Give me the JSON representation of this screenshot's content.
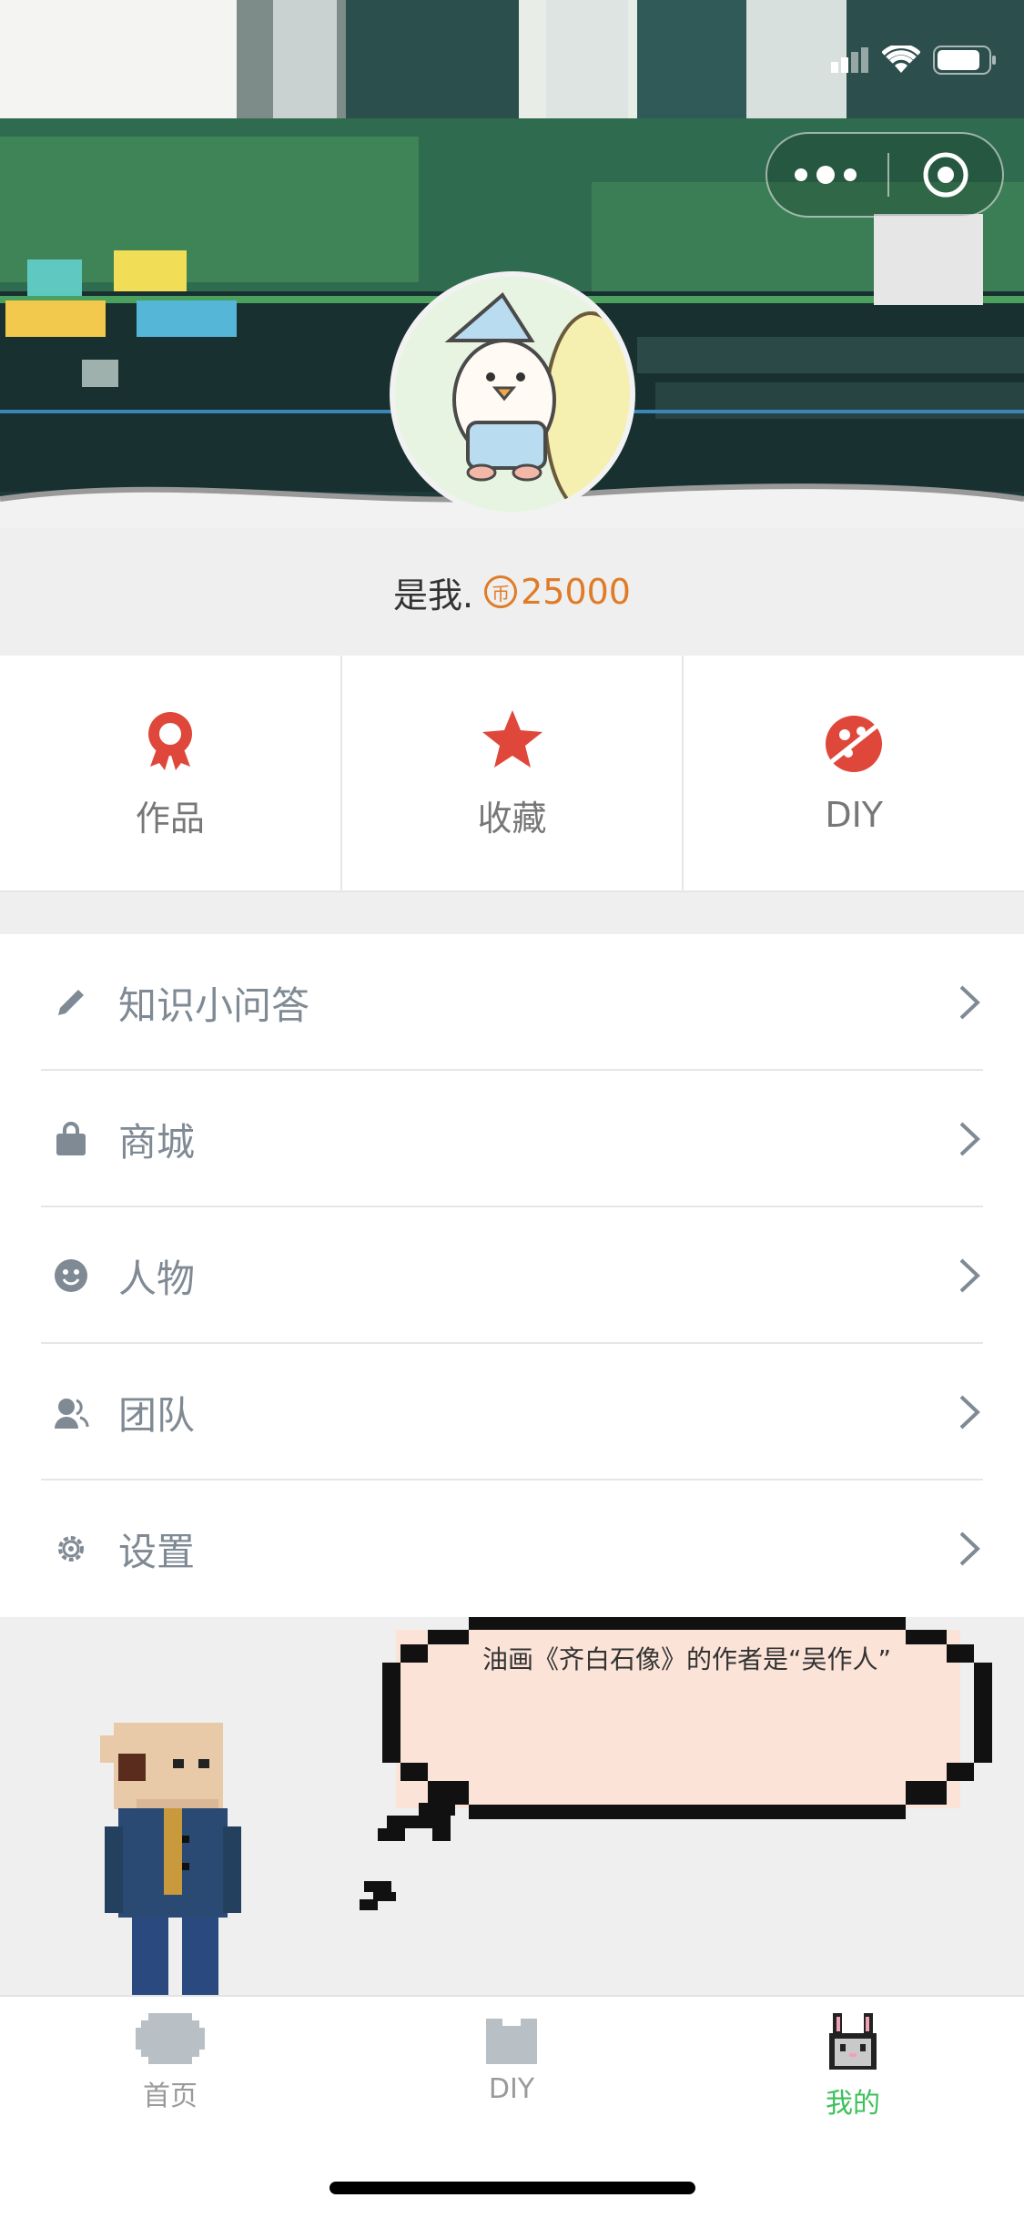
{
  "status_bar": {
    "icons": [
      "signal-icon",
      "wifi-icon",
      "battery-icon"
    ]
  },
  "capsule": {
    "more_icon": "more-dots-icon",
    "close_icon": "target-close-icon"
  },
  "profile": {
    "name": "是我.",
    "coin_symbol": "币",
    "coins": "25000",
    "coin_color": "#e07b27"
  },
  "tiles": [
    {
      "label": "作品",
      "icon": "award-ribbon-icon"
    },
    {
      "label": "收藏",
      "icon": "star-icon"
    },
    {
      "label": "DIY",
      "icon": "palette-icon"
    }
  ],
  "menu": [
    {
      "label": "知识小问答",
      "icon": "pencil-icon"
    },
    {
      "label": "商城",
      "icon": "shopping-bag-icon"
    },
    {
      "label": "人物",
      "icon": "smiley-icon"
    },
    {
      "label": "团队",
      "icon": "team-icon"
    },
    {
      "label": "设置",
      "icon": "gear-icon"
    }
  ],
  "speech_bubble": {
    "text": "油画《齐白石像》的作者是“吴作人”"
  },
  "tabbar": [
    {
      "label": "首页",
      "icon": "home-pixel-icon",
      "active": false
    },
    {
      "label": "DIY",
      "icon": "diy-pixel-icon",
      "active": false
    },
    {
      "label": "我的",
      "icon": "bunny-pixel-icon",
      "active": true
    }
  ],
  "colors": {
    "accent_red": "#e0473b",
    "active_green": "#3cc15a",
    "menu_text": "#7f8a94"
  }
}
